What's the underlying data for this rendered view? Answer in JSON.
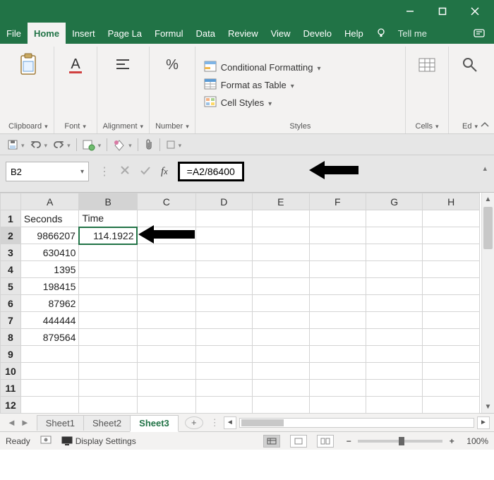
{
  "window": {
    "minimize": "–",
    "maximize": "",
    "close": ""
  },
  "tabs": {
    "file": "File",
    "home": "Home",
    "insert": "Insert",
    "pageLayout": "Page La",
    "formulas": "Formul",
    "data": "Data",
    "review": "Review",
    "view": "View",
    "developer": "Develo",
    "help": "Help",
    "tellme": "Tell me"
  },
  "ribbon": {
    "clipboard": "Clipboard",
    "font": "Font",
    "alignment": "Alignment",
    "number": "Number",
    "styles_label": "Styles",
    "cond_fmt": "Conditional Formatting",
    "fmt_table": "Format as Table",
    "cell_styles": "Cell Styles",
    "cells": "Cells",
    "editing": "Ed"
  },
  "namebox": "B2",
  "formula": "=A2/86400",
  "columns": [
    "A",
    "B",
    "C",
    "D",
    "E",
    "F",
    "G",
    "H"
  ],
  "rows": [
    "1",
    "2",
    "3",
    "4",
    "5",
    "6",
    "7",
    "8",
    "9",
    "10",
    "11",
    "12"
  ],
  "cells": {
    "A1": "Seconds",
    "B1": "Time",
    "A2": "9866207",
    "B2": "114.1922",
    "A3": "630410",
    "A4": "1395",
    "A5": "198415",
    "A6": "87962",
    "A7": "444444",
    "A8": "879564"
  },
  "sheets": {
    "s1": "Sheet1",
    "s2": "Sheet2",
    "s3": "Sheet3"
  },
  "status": {
    "ready": "Ready",
    "display": "Display Settings",
    "zoom": "100%"
  }
}
